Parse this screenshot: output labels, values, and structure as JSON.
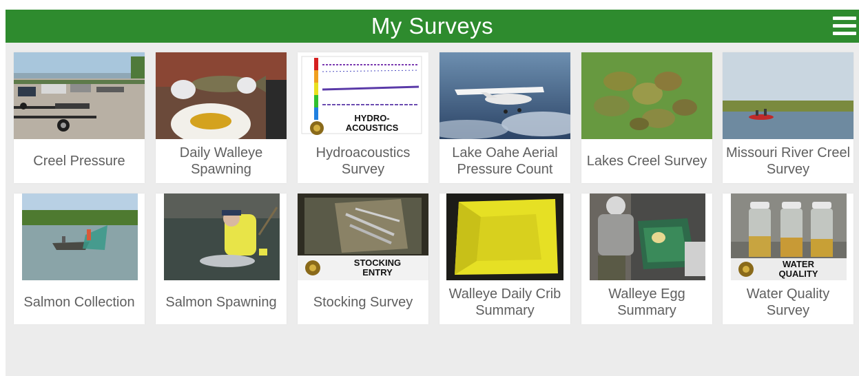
{
  "header": {
    "title": "My Surveys",
    "background": "#2e8b2e",
    "menu_icon": "hamburger-menu-icon"
  },
  "surveys": [
    {
      "label": "Creel Pressure",
      "image": "boat-trailers-parking-lot"
    },
    {
      "label": "Daily Walleye Spawning",
      "image": "hands-holding-walleye-over-bowl"
    },
    {
      "label": "Hydroacoustics Survey",
      "image": "sonar-echogram",
      "overlay_text": "HYDRO-ACOUSTICS"
    },
    {
      "label": "Lake Oahe Aerial Pressure Count",
      "image": "small-airplane-in-sky"
    },
    {
      "label": "Lakes Creel Survey",
      "image": "sunfish-on-grass"
    },
    {
      "label": "Missouri River Creel Survey",
      "image": "boat-on-river"
    },
    {
      "label": "Salmon Collection",
      "image": "boat-with-net-on-lake"
    },
    {
      "label": "Salmon Spawning",
      "image": "worker-holding-salmon"
    },
    {
      "label": "Stocking Survey",
      "image": "fish-in-bin",
      "overlay_text": "STOCKING ENTRY"
    },
    {
      "label": "Walleye Daily Crib Summary",
      "image": "yellow-crib-liner"
    },
    {
      "label": "Walleye Egg Summary",
      "image": "worker-at-egg-tank"
    },
    {
      "label": "Water Quality Survey",
      "image": "water-sample-jars",
      "overlay_text": "WATER QUALITY"
    }
  ]
}
